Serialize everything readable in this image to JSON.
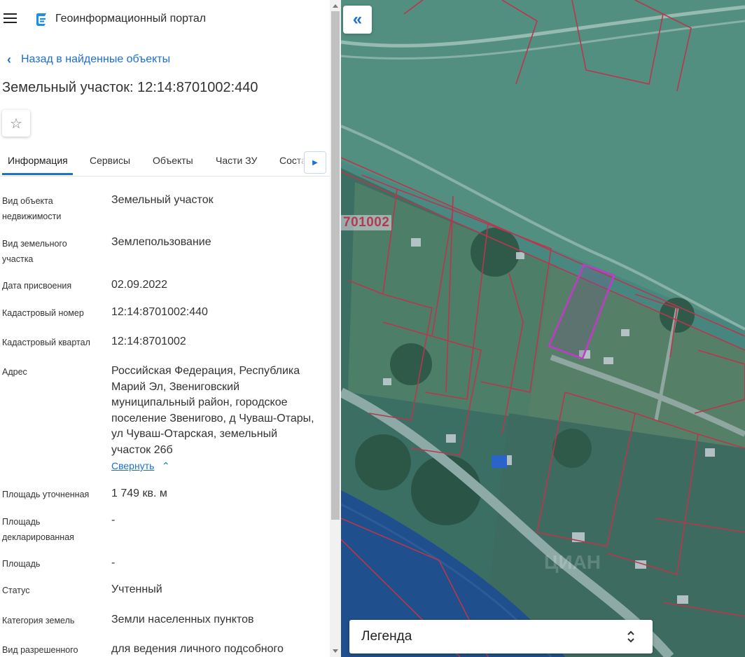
{
  "header": {
    "app_title": "Геоинформационный портал"
  },
  "back_link": {
    "label": "Назад в найденные объекты"
  },
  "page_title": "Земельный участок: 12:14:8701002:440",
  "tabs": [
    {
      "label": "Информация",
      "active": true
    },
    {
      "label": "Сервисы"
    },
    {
      "label": "Объекты"
    },
    {
      "label": "Части ЗУ"
    },
    {
      "label": "Состав"
    }
  ],
  "fields": [
    {
      "label": "Вид объекта недвижимости",
      "value": "Земельный участок"
    },
    {
      "label": "Вид земельного участка",
      "value": "Землепользование"
    },
    {
      "label": "Дата присвоения",
      "value": "02.09.2022"
    },
    {
      "label": "Кадастровый номер",
      "value": "12:14:8701002:440"
    },
    {
      "label": "Кадастровый квартал",
      "value": "12:14:8701002"
    },
    {
      "label": "Адрес",
      "value": "Российская Федерация, Республика Марий Эл, Звениговский муниципальный район, городское поселение Звенигово, д Чуваш-Отары, ул Чуваш-Отарская, земельный участок 26б"
    },
    {
      "label": "Площадь уточненная",
      "value": "1 749 кв. м"
    },
    {
      "label": "Площадь декларированная",
      "value": "-"
    },
    {
      "label": "Площадь",
      "value": "-"
    },
    {
      "label": "Статус",
      "value": "Учтенный"
    },
    {
      "label": "Категория земель",
      "value": "Земли населенных пунктов"
    },
    {
      "label": "Вид разрешенного",
      "value": "для ведения личного подсобного"
    }
  ],
  "collapse_link": "Свернуть",
  "map": {
    "quarter_label": "701002",
    "legend_label": "Легенда",
    "parcel_border_color": "#b8374d",
    "selected_parcel_color": "#c03cc8"
  },
  "icons": {
    "menu": "hamburger-icon",
    "logo": "portal-logo-icon",
    "back": "chevron-left-icon",
    "favorite": "star-icon",
    "tabs_next": "triangle-right-icon",
    "collapse": "chevron-up-icon",
    "map_toggle": "double-chevron-left-icon",
    "legend_toggle": "chevron-up-down-icon"
  }
}
